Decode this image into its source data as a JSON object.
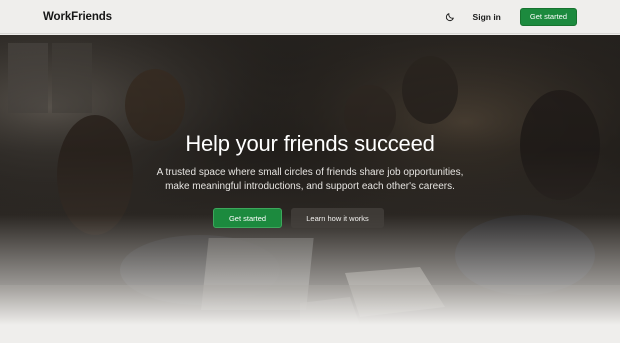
{
  "nav": {
    "logo": "WorkFriends",
    "theme_icon": "moon-icon",
    "signin_label": "Sign in",
    "get_started_label": "Get started"
  },
  "hero": {
    "title": "Help your friends succeed",
    "subtitle": "A trusted space where small circles of friends share job opportunities, make meaningful introductions, and support each other's careers.",
    "primary_label": "Get started",
    "secondary_label": "Learn how it works"
  },
  "colors": {
    "accent": "#1c8a3e",
    "background": "#efeeec"
  }
}
